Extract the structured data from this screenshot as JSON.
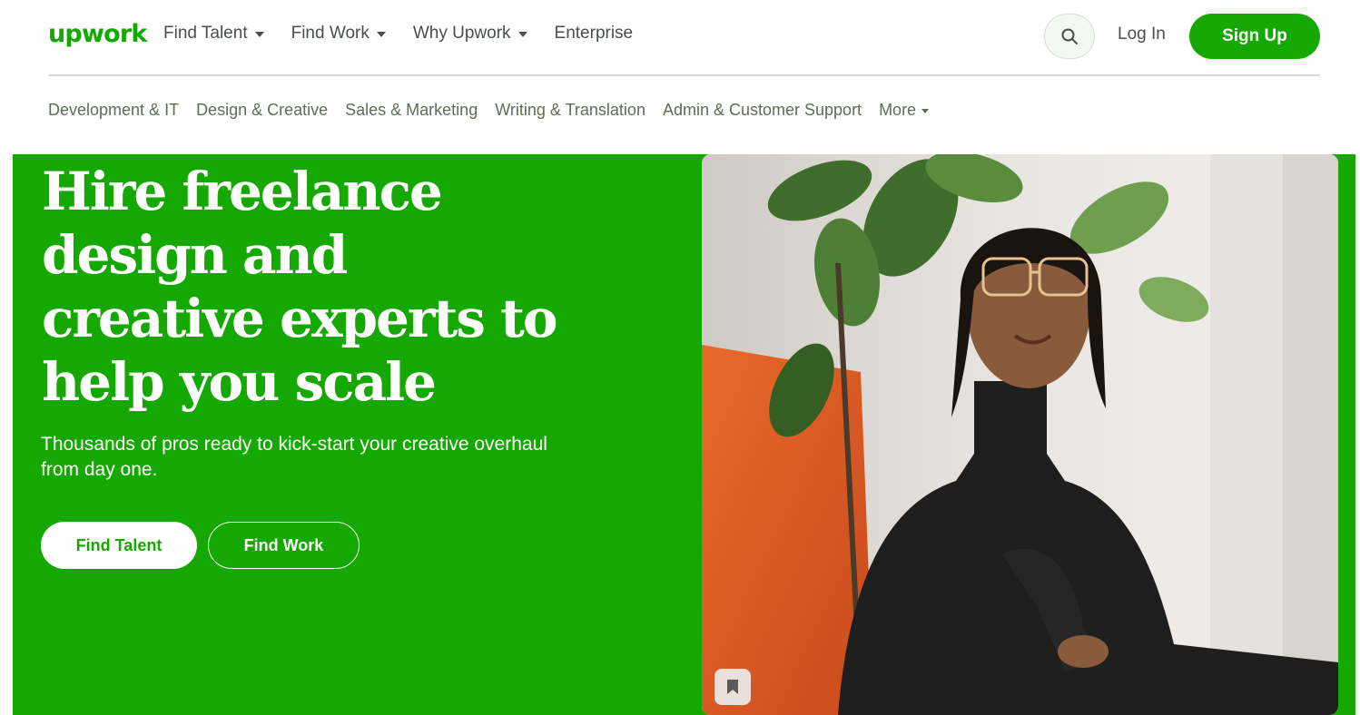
{
  "brand": {
    "logo_text": "upwork",
    "accent": "#14a800"
  },
  "nav": {
    "items": [
      {
        "label": "Find Talent",
        "has_menu": true
      },
      {
        "label": "Find Work",
        "has_menu": true
      },
      {
        "label": "Why Upwork",
        "has_menu": true
      },
      {
        "label": "Enterprise",
        "has_menu": false
      }
    ],
    "search_icon": "search-icon",
    "login_label": "Log In",
    "signup_label": "Sign Up"
  },
  "categories": {
    "items": [
      {
        "label": "Development & IT"
      },
      {
        "label": "Design & Creative"
      },
      {
        "label": "Sales & Marketing"
      },
      {
        "label": "Writing & Translation"
      },
      {
        "label": "Admin & Customer Support"
      },
      {
        "label": "More",
        "has_menu": true
      }
    ]
  },
  "hero": {
    "title_lines": [
      "Hire freelance",
      "design and",
      "creative experts to",
      "help you scale"
    ],
    "subtitle": "Thousands of pros ready to kick-start your creative overhaul from day one.",
    "primary_button": "Find Talent",
    "secondary_button": "Find Work",
    "image_description_icon": "bookmark-icon",
    "background_color": "#14a800"
  }
}
